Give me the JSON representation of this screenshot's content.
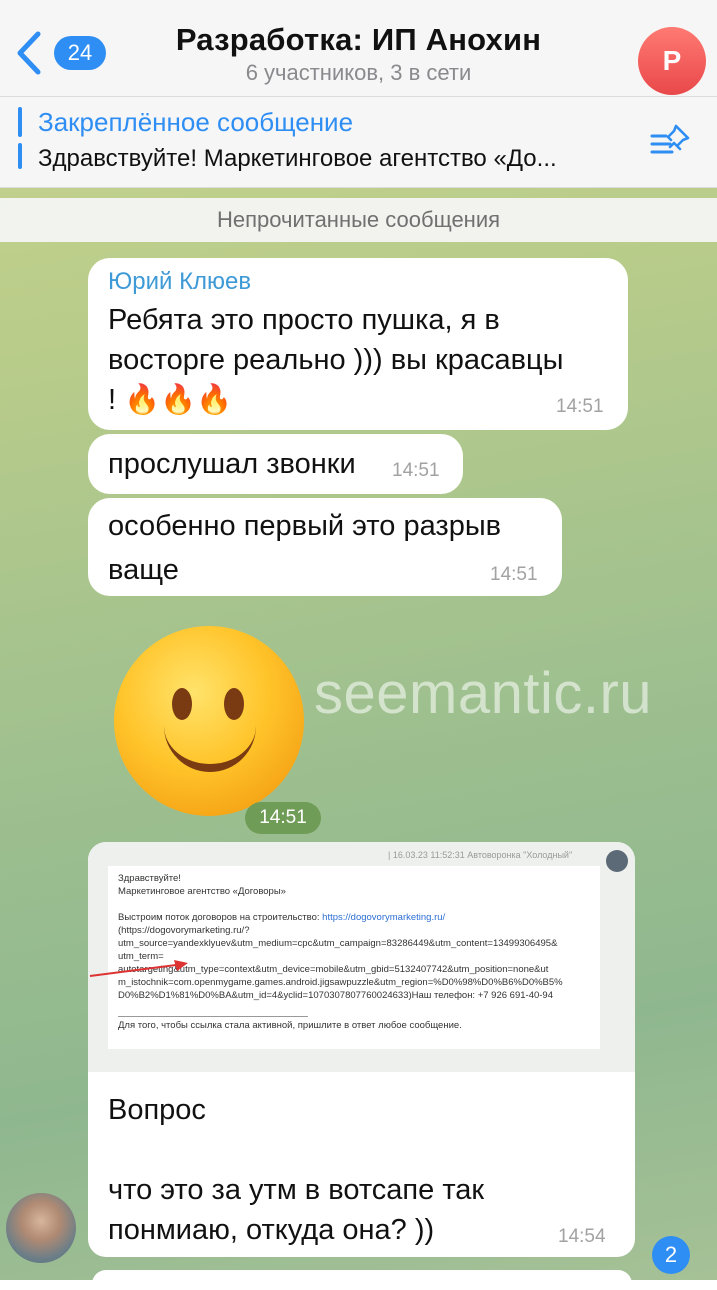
{
  "header": {
    "back_count": "24",
    "title": "Разработка: ИП Анохин",
    "subtitle": "6 участников, 3 в сети",
    "avatar_letter": "Р"
  },
  "pinned": {
    "title": "Закреплённое сообщение",
    "text": "Здравствуйте! Маркетинговое агентство «До..."
  },
  "unread_label": "Непрочитанные сообщения",
  "messages": [
    {
      "sender": "Юрий Клюев",
      "text_line1": "Ребята это просто пушка, я в",
      "text_line2": "восторге реально ))) вы красавцы",
      "text_line3": "! 🔥🔥🔥",
      "time": "14:51"
    },
    {
      "text": "прослушал звонки",
      "time": "14:51"
    },
    {
      "text_line1": "особенно первый это разрыв",
      "text_line2": "ваще",
      "time": "14:51"
    },
    {
      "sticker": "smiling-face",
      "time": "14:51"
    },
    {
      "screenshot": {
        "header": "| 16.03.23 11:52:31   Автоворонка \"Холодный\"",
        "line1": "Здравствуйте!",
        "line2": "Маркетинговое агентство «Договоры»",
        "line3": "Выстроим поток договоров на строительство: ",
        "link": "https://dogovorymarketing.ru/",
        "line4": "(https://dogovorymarketing.ru/?",
        "line5": "utm_source=yandexklyuev&utm_medium=cpc&utm_campaign=83286449&utm_content=13499306495&",
        "line6": "utm_term=",
        "line7": "autotargeting&utm_type=context&utm_device=mobile&utm_gbid=5132407742&utm_position=none&ut",
        "line8": "m_istochnik=com.openmygame.games.android.jigsawpuzzle&utm_region=%D0%98%D0%B6%D0%B5%",
        "line9": "D0%B2%D1%81%D0%BA&utm_id=4&yclid=1070307807760024633)Наш телефон: +7 926 691-40-94",
        "footer": "Для того, чтобы ссылка стала активной, пришлите в ответ любое сообщение."
      },
      "text_line1": "Вопрос",
      "text_line2": "что это за утм в вотсапе так",
      "text_line3": "понмиаю, откуда она? ))",
      "time": "14:54"
    }
  ],
  "watermark": "seemantic.ru",
  "scroll_badge": "2",
  "colors": {
    "accent": "#2f8ef3",
    "sender": "#3e9ad6",
    "avatar": "#e9484a"
  }
}
